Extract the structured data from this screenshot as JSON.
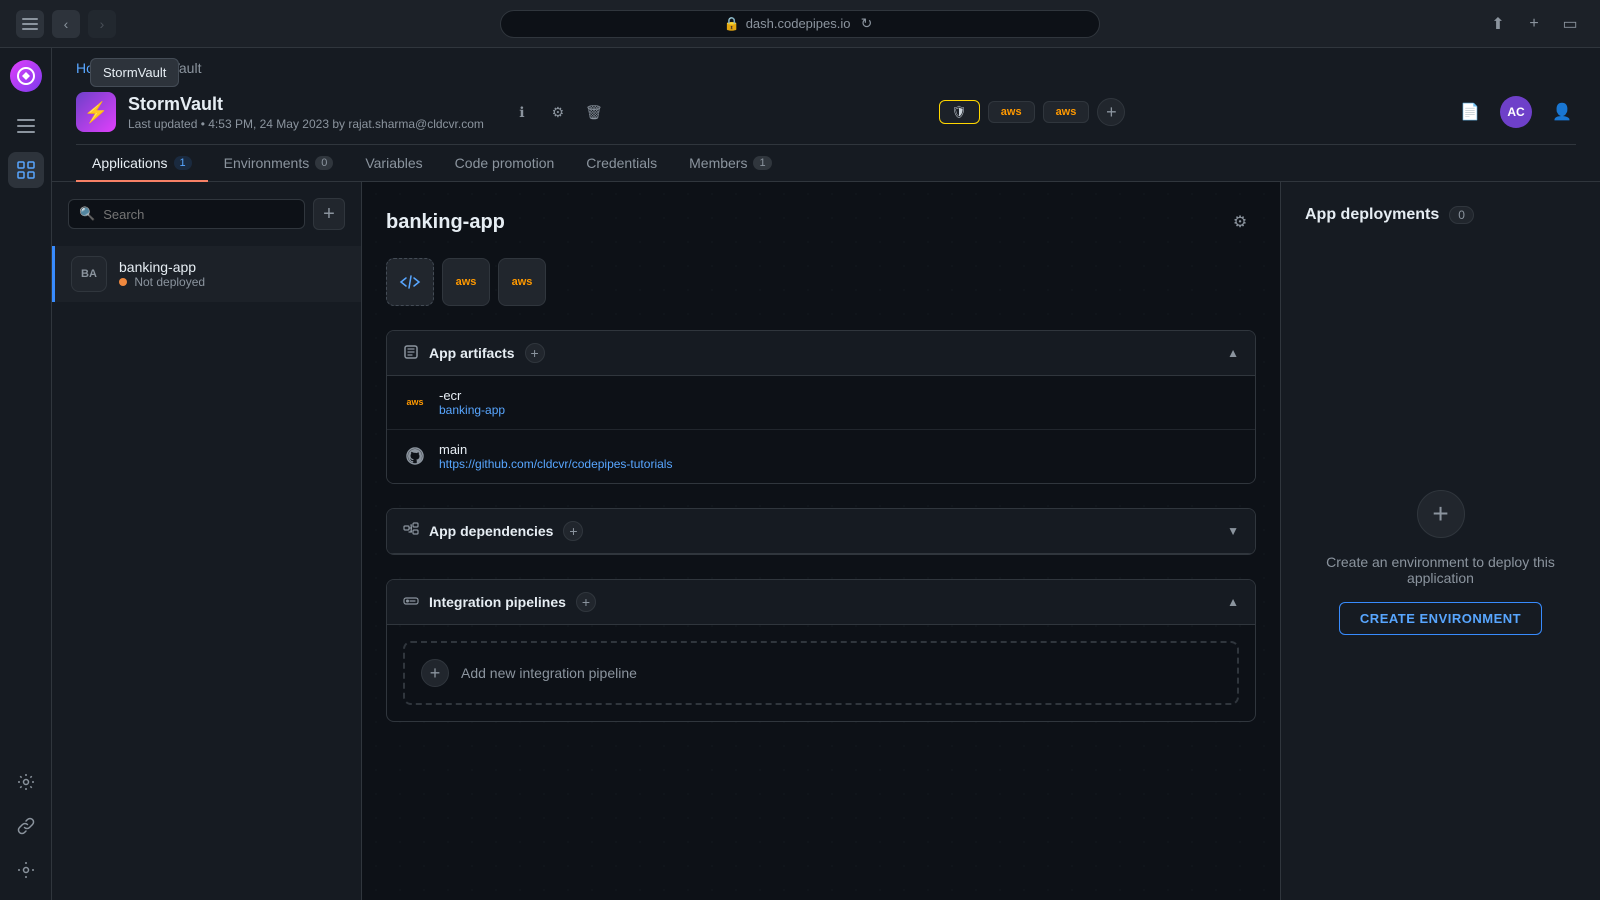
{
  "browser": {
    "url": "dash.codepipes.io",
    "back_disabled": false,
    "forward_disabled": true
  },
  "breadcrumb": {
    "home": "Home",
    "separator": "/",
    "current": "StormVault"
  },
  "tooltip": {
    "text": "StormVault"
  },
  "project": {
    "name": "StormVault",
    "meta": "Last updated • 4:53 PM, 24 May 2023 by rajat.sharma@cldcvr.com",
    "env_badges": [
      {
        "type": "shield",
        "label": ""
      },
      {
        "type": "aws",
        "label": "aws"
      },
      {
        "type": "aws2",
        "label": "aws"
      }
    ]
  },
  "tabs": [
    {
      "label": "Applications",
      "badge": "1",
      "active": true
    },
    {
      "label": "Environments",
      "badge": "0",
      "active": false
    },
    {
      "label": "Variables",
      "badge": "",
      "active": false
    },
    {
      "label": "Code promotion",
      "badge": "",
      "active": false
    },
    {
      "label": "Credentials",
      "badge": "",
      "active": false
    },
    {
      "label": "Members",
      "badge": "1",
      "active": false
    }
  ],
  "sidebar": {
    "search_placeholder": "Search",
    "add_button_label": "+",
    "apps": [
      {
        "initials": "BA",
        "name": "banking-app",
        "status": "Not deployed",
        "active": true
      }
    ]
  },
  "app_detail": {
    "name": "banking-app",
    "icons": [
      "code",
      "aws",
      "aws2"
    ],
    "artifacts": {
      "title": "App artifacts",
      "items": [
        {
          "type": "aws",
          "name": "-ecr",
          "sub": "banking-app"
        },
        {
          "type": "github",
          "name": "main",
          "sub": "https://github.com/cldcvr/codepipes-tutorials"
        }
      ]
    },
    "dependencies": {
      "title": "App dependencies"
    },
    "pipelines": {
      "title": "Integration pipelines",
      "add_label": "Add new integration pipeline"
    }
  },
  "deployments": {
    "title": "App deployments",
    "count": "0",
    "create_text": "Create an environment to deploy this application",
    "create_btn": "CREATE ENVIRONMENT"
  },
  "user": {
    "initials": "AC"
  }
}
